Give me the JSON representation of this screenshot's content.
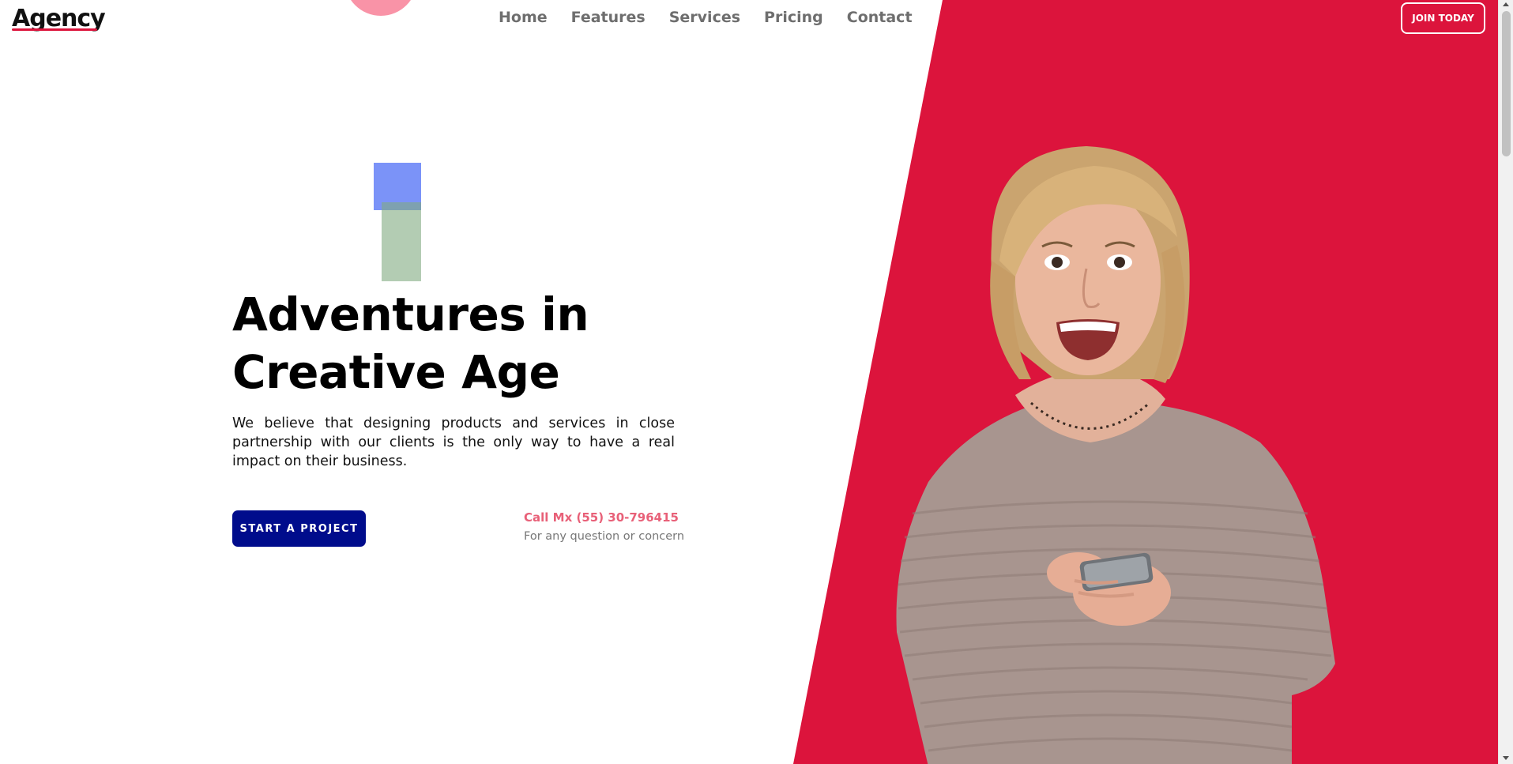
{
  "header": {
    "logo": "Agency",
    "nav": [
      "Home",
      "Features",
      "Services",
      "Pricing",
      "Contact"
    ],
    "join_label": "JOIN TODAY"
  },
  "hero": {
    "title": "Adventures in Creative Age",
    "description": "We believe that designing products and services in close partnership with our clients is the only way to have a real impact on their business.",
    "cta_label": "START A PROJECT",
    "call_label": "Call Mx (55) 30-796415",
    "call_sub": "For any question or concern"
  },
  "colors": {
    "accent_red": "#dc143c",
    "cta_navy": "#000c8c",
    "pink": "#f993a7",
    "blue_square": "#7b93f8",
    "green_square": "#80aa80"
  }
}
